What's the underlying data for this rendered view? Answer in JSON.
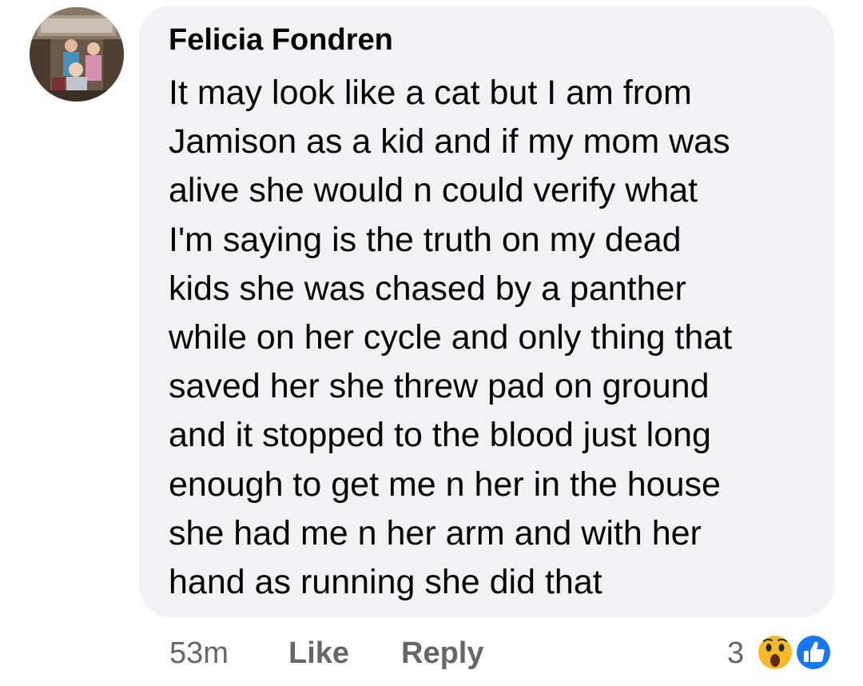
{
  "comment": {
    "author": "Felicia Fondren",
    "text_lines": [
      "It may look like a cat but I am from",
      "Jamison as a kid and if my mom was",
      "alive she would n could verify what",
      "I'm saying is the truth on my dead",
      "kids she was chased by a panther",
      "while on her cycle and only thing that",
      "saved her she threw pad on ground",
      "and it stopped to the blood just long",
      "enough to get me n her in the house",
      "she had me n her arm and with her",
      "hand as running she did that"
    ],
    "avatar_icon": "profile-photo",
    "bubble_color": "#f0f2f5"
  },
  "actions": {
    "timestamp": "53m",
    "like_label": "Like",
    "reply_label": "Reply"
  },
  "reactions": {
    "count": "3",
    "icons": [
      "wow-reaction-icon",
      "like-reaction-icon"
    ],
    "like_color": "#1877f2",
    "wow_color": "#f7b928"
  }
}
